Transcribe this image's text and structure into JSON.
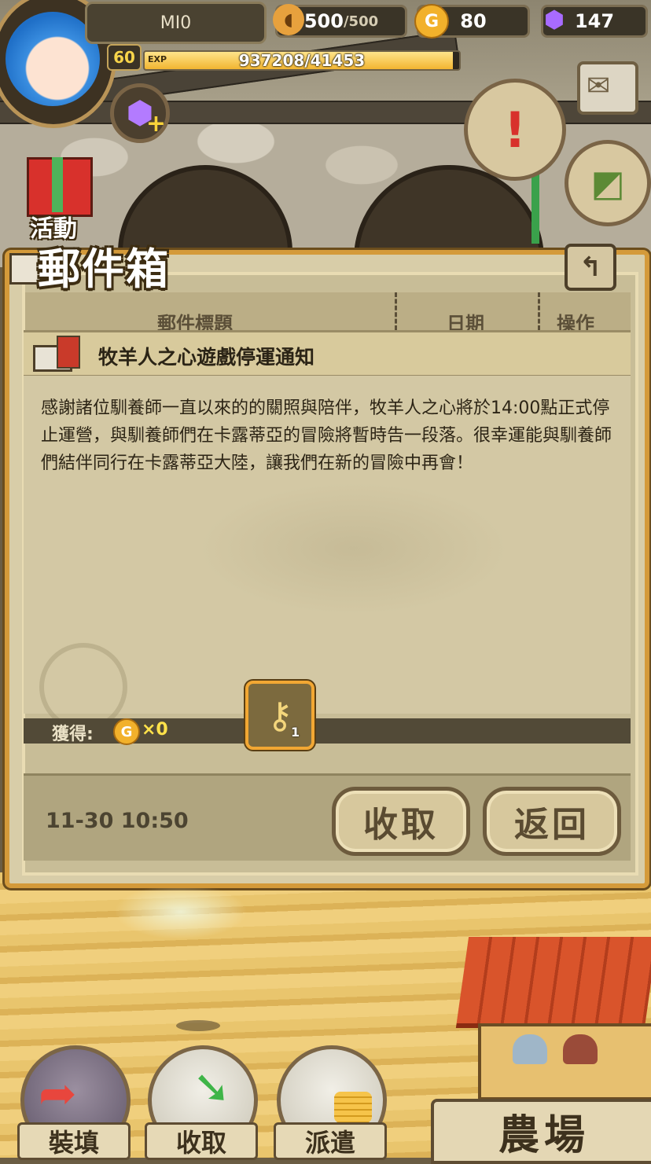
{
  "hud": {
    "player_name": "MI0",
    "level": "60",
    "exp_tag": "EXP",
    "exp_text": "937208/41453",
    "exp_fraction": 0.98,
    "bread": {
      "current": "500",
      "max": "/500"
    },
    "gold": "80",
    "gem": "147",
    "activity_label": "活動"
  },
  "mailbox": {
    "title": "郵件箱",
    "columns": [
      "郵件標題",
      "日期",
      "操作"
    ],
    "mail": {
      "subject": "牧羊人之心遊戲停運通知",
      "body": "感謝諸位馴養師一直以來的的關照與陪伴，牧羊人之心將於14:00點正式停止運營，與馴養師們在卡露蒂亞的冒險將暫時告一段落。很幸運能與馴養師們結伴同行在卡露蒂亞大陸，讓我們在新的冒險中再會！",
      "reward_label": "獲得:",
      "reward_coin_symbol": "G",
      "reward_amount": "×0",
      "item_count": "1",
      "date": "11-30 10:50"
    },
    "buttons": {
      "collect": "收取",
      "return": "返回"
    }
  },
  "bottom_nav": {
    "equip": "裝填",
    "collect": "收取",
    "dispatch": "派遣",
    "farm": "農場"
  },
  "colors": {
    "dialog_border": "#d49a3a",
    "gold": "#f2b12b",
    "gem": "#8b4fd8",
    "exp_fill": "#f2b531"
  }
}
